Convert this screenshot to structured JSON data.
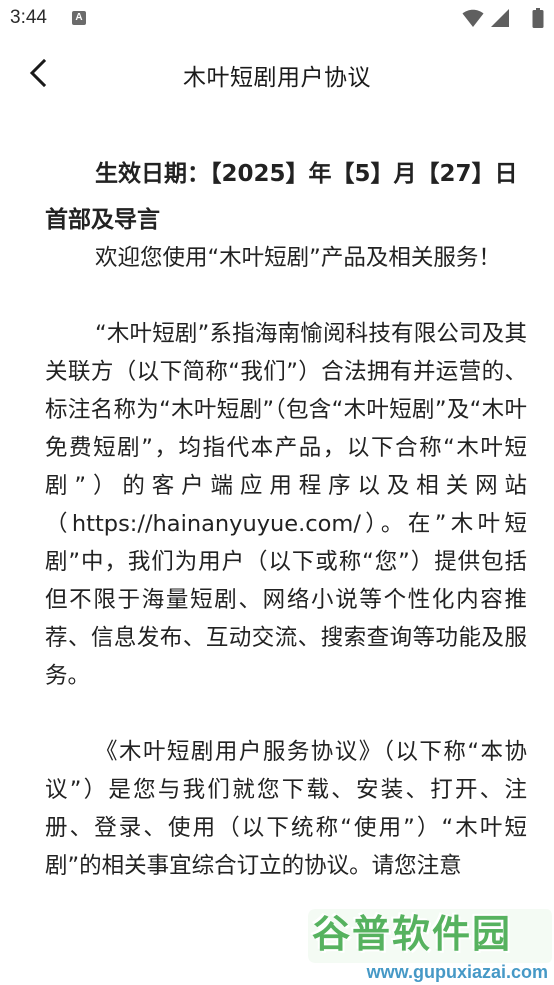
{
  "status_bar": {
    "time": "3:44",
    "notification_icon": "A"
  },
  "header": {
    "title": "木叶短剧用户协议"
  },
  "document": {
    "effective_date": "生效日期：【2025】年【5】月【27】日",
    "section_heading": "首部及导言",
    "paragraphs": [
      "欢迎您使用“木叶短剧”产品及相关服务！",
      "“木叶短剧”系指海南愉阅科技有限公司及其关联方（以下简称“我们”）合法拥有并运营的、标注名称为“木叶短剧”（包含“木叶短剧”及“木叶免费短剧”，均指代本产品，以下合称“木叶短剧”）的客户端应用程序以及相关网站（https://hainanyuyue.com/）。在”木叶短剧”中，我们为用户（以下或称“您”）提供包括但不限于海量短剧、网络小说等个性化内容推荐、信息发布、互动交流、搜索查询等功能及服务。",
      "《木叶短剧用户服务协议》（以下称“本协议”）是您与我们就您下载、安装、打开、注册、登录、使用（以下统称“使用”）“木叶短剧”的相关事宜综合订立的协议。请您注意"
    ]
  },
  "watermark": {
    "title": "谷普软件园",
    "url": "www.gupuxiazai.com"
  }
}
